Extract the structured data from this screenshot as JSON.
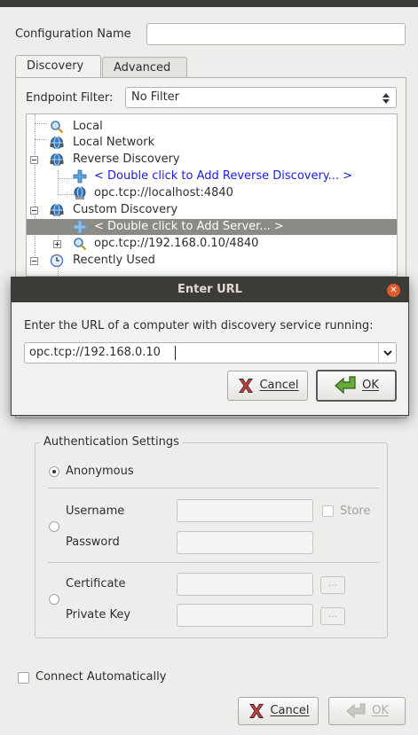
{
  "config": {
    "name_label": "Configuration Name",
    "name_value": ""
  },
  "tabs": [
    {
      "label": "Discovery",
      "active": true
    },
    {
      "label": "Advanced",
      "active": false
    }
  ],
  "endpoint_filter": {
    "label": "Endpoint Filter:",
    "value": "No Filter"
  },
  "tree": {
    "items": [
      {
        "label": "Local",
        "icon": "magnifier-icon"
      },
      {
        "label": "Local Network",
        "icon": "network-globe-icon"
      },
      {
        "label": "Reverse Discovery",
        "icon": "network-globe-icon"
      },
      {
        "label": "< Double click to Add Reverse Discovery... >",
        "icon": "plus-icon"
      },
      {
        "label": "opc.tcp://localhost:4840",
        "icon": "globe-server-icon"
      },
      {
        "label": "Custom Discovery",
        "icon": "network-globe-icon"
      },
      {
        "label": "< Double click to Add Server... >",
        "icon": "plus-icon"
      },
      {
        "label": "opc.tcp://192.168.0.10/4840",
        "icon": "magnifier-icon"
      },
      {
        "label": "Recently Used",
        "icon": "clock-icon"
      }
    ]
  },
  "dialog": {
    "title": "Enter URL",
    "prompt": "Enter the URL of a computer with discovery service running:",
    "url_value": "opc.tcp://192.168.0.10",
    "cancel_label": "Cancel",
    "ok_label": "OK"
  },
  "auth": {
    "group_title": "Authentication Settings",
    "anonymous_label": "Anonymous",
    "username_label": "Username",
    "password_label": "Password",
    "store_label": "Store",
    "certificate_label": "Certificate",
    "private_key_label": "Private Key",
    "browse_label": "..."
  },
  "connect_automatically_label": "Connect Automatically",
  "footer": {
    "cancel_label": "Cancel",
    "ok_label": "OK"
  },
  "colors": {
    "titlebar": "#3c3b37",
    "selection": "#8c8a85",
    "link_blue": "#1a1ae6",
    "close_orange": "#e05a2c"
  }
}
